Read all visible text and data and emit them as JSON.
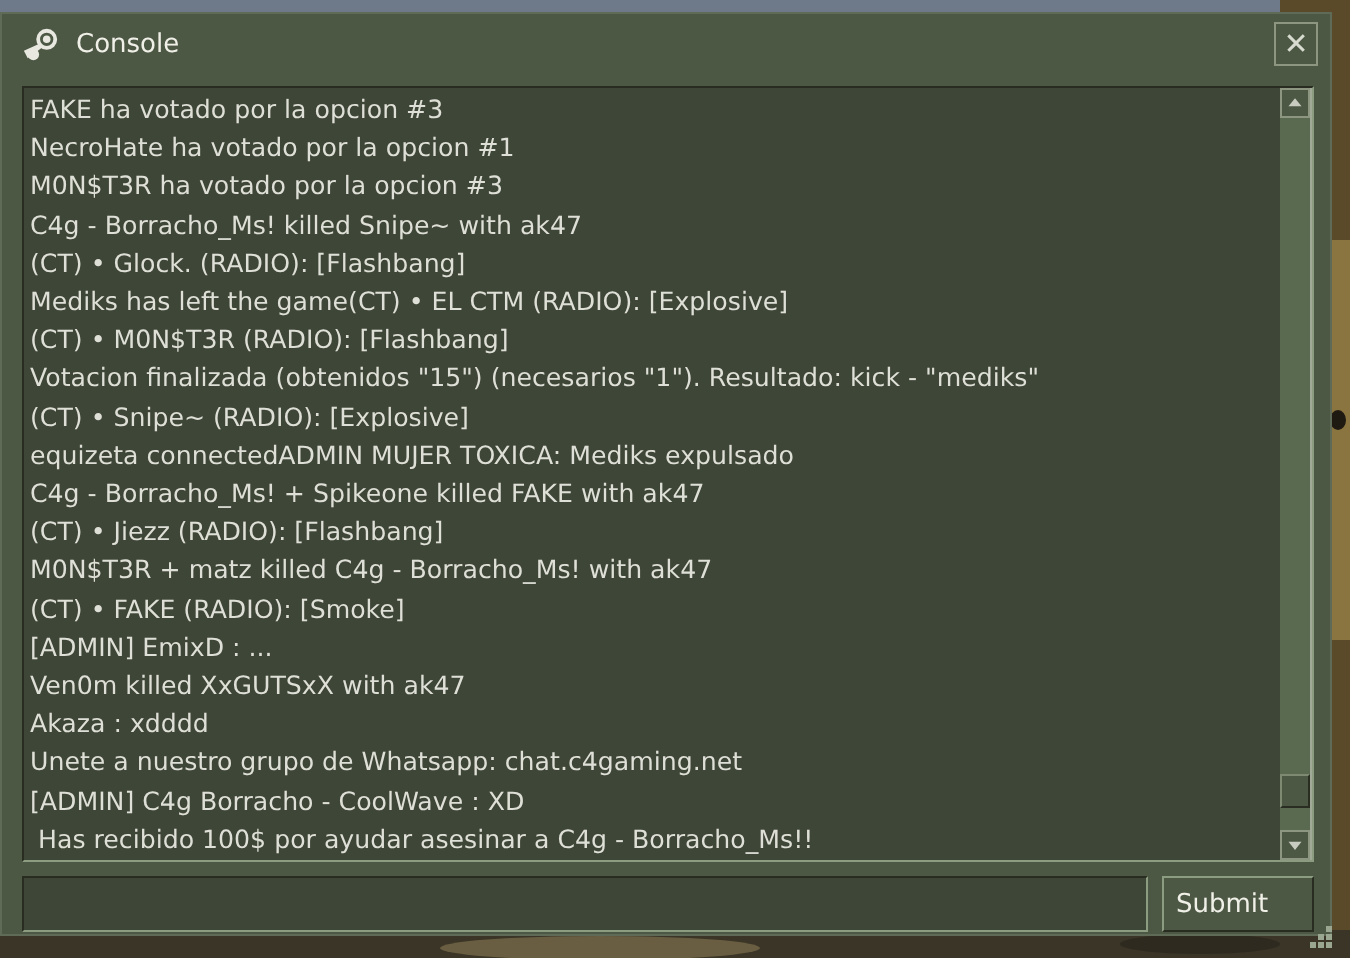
{
  "window": {
    "title": "Console",
    "close_label": "✕"
  },
  "log": [
    "FAKE ha votado por la opcion #3",
    "NecroHate ha votado por la opcion #1",
    "M0N$T3R ha votado por la opcion #3",
    "C4g - Borracho_Ms! killed Snipe~ with ak47",
    "(CT) • Glock. (RADIO): [Flashbang]",
    "Mediks has left the game(CT) • EL CTM (RADIO): [Explosive]",
    "(CT) • M0N$T3R (RADIO): [Flashbang]",
    "Votacion finalizada (obtenidos \"15\") (necesarios \"1\"). Resultado: kick - \"mediks\"",
    "(CT) • Snipe~ (RADIO): [Explosive]",
    "equizeta connectedADMIN MUJER TOXICA: Mediks expulsado",
    "C4g - Borracho_Ms! + Spikeone killed FAKE with ak47",
    "(CT) • Jiezz (RADIO): [Flashbang]",
    "M0N$T3R + matz killed C4g - Borracho_Ms! with ak47",
    "(CT) • FAKE (RADIO): [Smoke]",
    "[ADMIN] EmixD : ...",
    "Ven0m killed XxGUTSxX with ak47",
    "Akaza : xdddd",
    "Unete a nuestro grupo de Whatsapp: chat.c4gaming.net",
    "[ADMIN] C4g Borracho - CoolWave : XD",
    " Has recibido 100$ por ayudar asesinar a C4g - Borracho_Ms!!"
  ],
  "submit_button": {
    "label": "Submit"
  }
}
